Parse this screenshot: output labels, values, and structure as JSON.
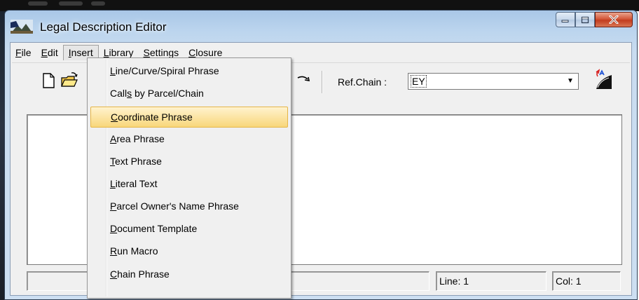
{
  "window": {
    "title": "Legal Description Editor"
  },
  "menubar": [
    {
      "key": "F",
      "rest": "ile"
    },
    {
      "key": "E",
      "rest": "dit"
    },
    {
      "key": "I",
      "rest": "nsert"
    },
    {
      "key": "L",
      "rest": "ibrary"
    },
    {
      "key": "S",
      "rest": "ettings"
    },
    {
      "key": "C",
      "rest": "losure"
    }
  ],
  "toolbar": {
    "refchain_label": "Ref.Chain :",
    "refchain_value": "EY"
  },
  "insert_menu": [
    {
      "pre": "",
      "key": "L",
      "rest": "ine/Curve/Spiral Phrase"
    },
    {
      "pre": "Call",
      "key": "s",
      "rest": " by Parcel/Chain"
    },
    {
      "pre": "",
      "key": "C",
      "rest": "oordinate Phrase"
    },
    {
      "pre": "",
      "key": "A",
      "rest": "rea Phrase"
    },
    {
      "pre": "",
      "key": "T",
      "rest": "ext Phrase"
    },
    {
      "pre": "",
      "key": "L",
      "rest": "iteral Text"
    },
    {
      "pre": "",
      "key": "P",
      "rest": "arcel Owner's Name Phrase"
    },
    {
      "pre": "",
      "key": "D",
      "rest": "ocument Template"
    },
    {
      "pre": "",
      "key": "R",
      "rest": "un Macro"
    },
    {
      "pre": "",
      "key": "C",
      "rest": "hain Phrase"
    }
  ],
  "status": {
    "line": "Line: 1",
    "col": "Col: 1"
  },
  "icons": [
    "app-icon",
    "minimize-icon",
    "maximize-icon",
    "close-icon",
    "new-document-icon",
    "open-folder-icon",
    "redo-arrow-icon",
    "chevron-down-icon",
    "ref-chain-icon"
  ],
  "colors": {
    "menu_highlight": "#fce5a4",
    "close_button": "#c23c1e",
    "titlebar": "#bcd5ee"
  }
}
